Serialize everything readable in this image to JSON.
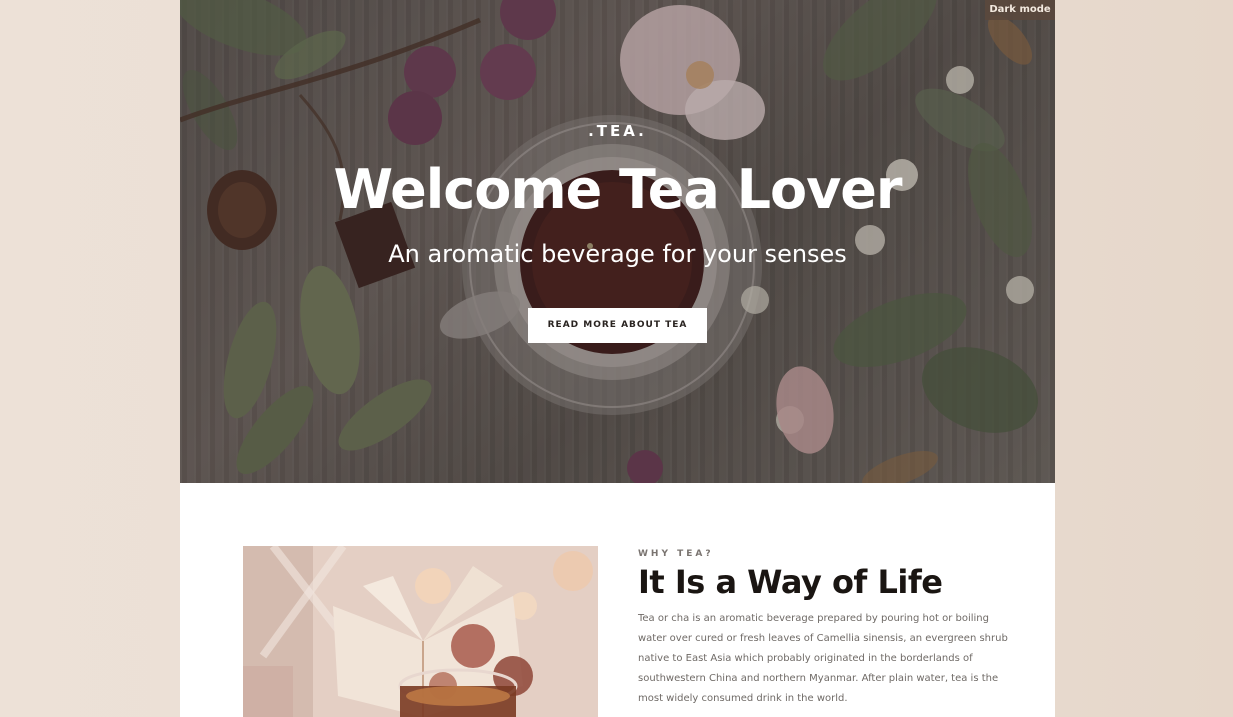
{
  "hero": {
    "dark_mode_label": "Dark mode",
    "brand": ".TEA.",
    "title": "Welcome Tea Lover",
    "subtitle": "An aromatic beverage for your senses",
    "cta_label": "READ MORE ABOUT TEA"
  },
  "about": {
    "eyebrow": "WHY TEA?",
    "title": "It Is a Way of Life",
    "body": "Tea or cha is an aromatic beverage prepared by pouring hot or boiling water over cured or fresh leaves of Camellia sinensis, an evergreen shrub native to East Asia which probably originated in the borderlands of southwestern China and northern Myanmar. After plain water, tea is the most widely consumed drink in the world."
  },
  "colors": {
    "page_background": "#ede1d7",
    "content_background": "#ffffff",
    "heading": "#1a1512",
    "body_text": "#6f6a66",
    "toggle_background": "#5a483c"
  }
}
